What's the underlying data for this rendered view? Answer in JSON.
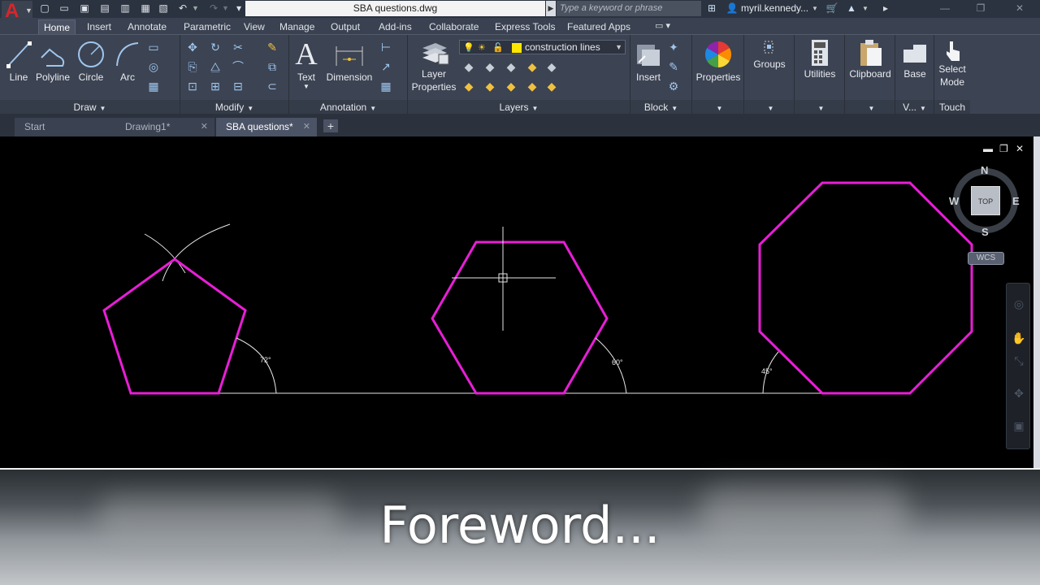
{
  "titlebar": {
    "doc_title": "SBA questions.dwg",
    "search_placeholder": "Type a keyword or phrase",
    "user_name": "myril.kennedy..."
  },
  "ribbon_tabs": [
    {
      "label": "Home",
      "active": true
    },
    {
      "label": "Insert"
    },
    {
      "label": "Annotate"
    },
    {
      "label": "Parametric"
    },
    {
      "label": "View"
    },
    {
      "label": "Manage"
    },
    {
      "label": "Output"
    },
    {
      "label": "Add-ins"
    },
    {
      "label": "Collaborate"
    },
    {
      "label": "Express Tools"
    },
    {
      "label": "Featured Apps"
    }
  ],
  "ribbon": {
    "draw": {
      "title": "Draw",
      "line": "Line",
      "polyline": "Polyline",
      "circle": "Circle",
      "arc": "Arc"
    },
    "modify": {
      "title": "Modify"
    },
    "annotation": {
      "title": "Annotation",
      "text": "Text",
      "dimension": "Dimension"
    },
    "layers": {
      "title": "Layers",
      "layer_properties_line1": "Layer",
      "layer_properties_line2": "Properties",
      "current_layer": "construction lines",
      "current_layer_color": "#ffe600"
    },
    "block": {
      "title": "Block",
      "insert": "Insert"
    },
    "properties": {
      "label": "Properties"
    },
    "groups": {
      "label": "Groups"
    },
    "utilities": {
      "label": "Utilities"
    },
    "clipboard": {
      "label": "Clipboard"
    },
    "view": {
      "base": "Base",
      "title": "V..."
    },
    "touch": {
      "select_mode_line1": "Select",
      "select_mode_line2": "Mode",
      "title": "Touch"
    }
  },
  "file_tabs": [
    {
      "label": "Start"
    },
    {
      "label": "Drawing1*"
    },
    {
      "label": "SBA questions*",
      "active": true
    }
  ],
  "drawing": {
    "angle_pentagon": "72°",
    "angle_hexagon": "60°",
    "angle_octagon": "45°",
    "polygon_color": "#e81ed6"
  },
  "viewcube": {
    "north": "N",
    "south": "S",
    "east": "E",
    "west": "W",
    "top": "TOP",
    "wcs": "WCS"
  },
  "caption": "Foreword..."
}
